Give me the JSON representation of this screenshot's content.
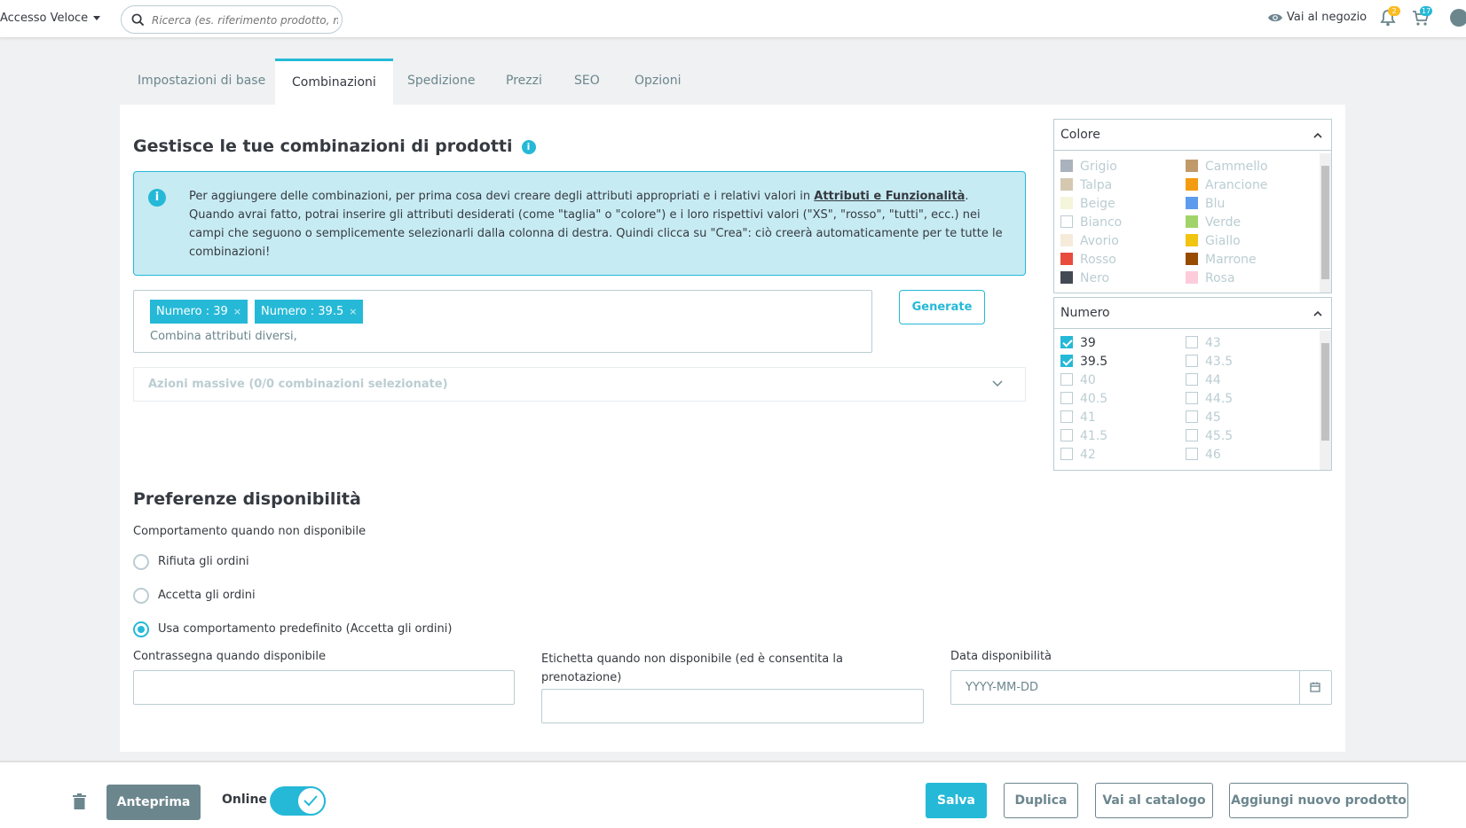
{
  "header": {
    "quick_access": "Accesso Veloce",
    "search_placeholder": "Ricerca (es. riferimento prodotto, nom",
    "shop_link": "Vai al negozio",
    "notifications_count": "2",
    "orders_count": "17"
  },
  "tabs": [
    "Impostazioni di base",
    "Combinazioni",
    "Spedizione",
    "Prezzi",
    "SEO",
    "Opzioni"
  ],
  "active_tab": "Combinazioni",
  "combinations": {
    "title": "Gestisce le tue combinazioni di prodotti",
    "alert_text_before": "Per aggiungere delle combinazioni, per prima cosa devi creare degli attributi appropriati e i relativi valori in ",
    "alert_link": "Attributi e Funzionalità",
    "alert_text_after": ". Quando avrai fatto, potrai inserire gli attributi desiderati (come \"taglia\" o \"colore\") e i loro rispettivi valori (\"XS\", \"rosso\", \"tutti\", ecc.) nei campi che seguono o semplicemente selezionarli dalla colonna di destra. Quindi clicca su \"Crea\": ciò creerà automaticamente per te tutte le combinazioni!",
    "tags": [
      "Numero : 39",
      "Numero : 39.5"
    ],
    "input_hint": "Combina attributi diversi,",
    "generate_label": "Generate",
    "bulk_actions": "Azioni massive (0/0 combinazioni selezionate)"
  },
  "availability": {
    "title": "Preferenze disponibilità",
    "behavior_label": "Comportamento quando non disponibile",
    "options": [
      "Rifiuta gli ordini",
      "Accetta gli ordini",
      "Usa comportamento predefinito (Accetta gli ordini)"
    ],
    "selected_option": "Usa comportamento predefinito (Accetta gli ordini)",
    "label_in_stock": "Contrassegna quando disponibile",
    "label_out_of_stock": "Etichetta quando non disponibile (ed è consentita la prenotazione)",
    "label_date": "Data disponibilità",
    "date_placeholder": "YYYY-MM-DD"
  },
  "attribute_panels": {
    "colore": {
      "title": "Colore",
      "col1": [
        {
          "name": "Grigio",
          "color": "#aab2bd"
        },
        {
          "name": "Talpa",
          "color": "#d5c8b1"
        },
        {
          "name": "Beige",
          "color": "#f5f5dc"
        },
        {
          "name": "Bianco",
          "color": "#ffffff"
        },
        {
          "name": "Avorio",
          "color": "#f6eadb"
        },
        {
          "name": "Rosso",
          "color": "#e84c3d"
        },
        {
          "name": "Nero",
          "color": "#434a54"
        }
      ],
      "col2": [
        {
          "name": "Cammello",
          "color": "#c19a6b"
        },
        {
          "name": "Arancione",
          "color": "#f39c11"
        },
        {
          "name": "Blu",
          "color": "#5d9cec"
        },
        {
          "name": "Verde",
          "color": "#a0d468"
        },
        {
          "name": "Giallo",
          "color": "#f1c40f"
        },
        {
          "name": "Marrone",
          "color": "#964b00"
        },
        {
          "name": "Rosa",
          "color": "#fcccdb"
        }
      ]
    },
    "numero": {
      "title": "Numero",
      "col1": [
        {
          "name": "39",
          "checked": true
        },
        {
          "name": "39.5",
          "checked": true
        },
        {
          "name": "40",
          "checked": false
        },
        {
          "name": "40.5",
          "checked": false
        },
        {
          "name": "41",
          "checked": false
        },
        {
          "name": "41.5",
          "checked": false
        },
        {
          "name": "42",
          "checked": false
        }
      ],
      "col2": [
        {
          "name": "43",
          "checked": false
        },
        {
          "name": "43.5",
          "checked": false
        },
        {
          "name": "44",
          "checked": false
        },
        {
          "name": "44.5",
          "checked": false
        },
        {
          "name": "45",
          "checked": false
        },
        {
          "name": "45.5",
          "checked": false
        },
        {
          "name": "46",
          "checked": false
        }
      ]
    }
  },
  "footer": {
    "preview": "Anteprima",
    "online_label": "Online",
    "online": true,
    "save": "Salva",
    "duplicate": "Duplica",
    "catalog": "Vai al catalogo",
    "add_new": "Aggiungi nuovo prodotto"
  },
  "colors": {
    "accent": "#25b9d7",
    "text": "#363a41",
    "muted": "#6c868e"
  }
}
